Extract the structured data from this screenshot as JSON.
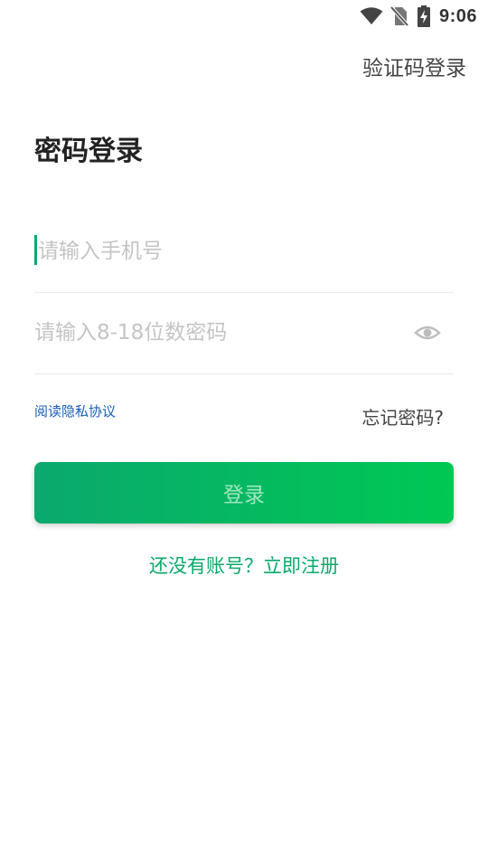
{
  "status_bar": {
    "time": "9:06",
    "icons": [
      "wifi-icon",
      "no-sim-icon",
      "battery-charging-icon"
    ]
  },
  "header": {
    "switch_login_label": "验证码登录"
  },
  "page": {
    "title": "密码登录"
  },
  "form": {
    "phone": {
      "value": "",
      "placeholder": "请输入手机号"
    },
    "password": {
      "value": "",
      "placeholder": "请输入8-18位数密码",
      "visibility_icon": "eye-icon"
    },
    "privacy_label": "阅读隐私协议",
    "forgot_label": "忘记密码?",
    "login_label": "登录",
    "register_label": "还没有账号？立即注册"
  },
  "colors": {
    "accent": "#0aa96a",
    "button_gradient_start": "#0aa96e",
    "button_gradient_end": "#00c853",
    "button_text": "#9fe6c2",
    "link_blue": "#1a5fb4",
    "placeholder": "#c4c4c4",
    "divider": "#ececec"
  }
}
